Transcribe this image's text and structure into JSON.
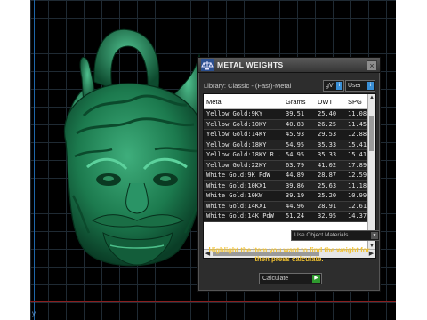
{
  "panel": {
    "title": "METAL WEIGHTS",
    "close": "×",
    "library_label": "Library: Classic - (Fast)-Metal",
    "button_gv": "gV",
    "button_user": "User",
    "indicator": "i"
  },
  "table": {
    "headers": [
      "Metal",
      "Grams",
      "DWT",
      "SPG"
    ],
    "rows": [
      [
        "Yellow Gold:9KY",
        "39.51",
        "25.40",
        "11.08"
      ],
      [
        "Yellow Gold:10KY",
        "40.83",
        "26.25",
        "11.45"
      ],
      [
        "Yellow Gold:14KY",
        "45.93",
        "29.53",
        "12.88"
      ],
      [
        "Yellow Gold:18KY",
        "54.95",
        "35.33",
        "15.41"
      ],
      [
        "Yellow Gold:18KY R...",
        "54.95",
        "35.33",
        "15.41"
      ],
      [
        "Yellow Gold:22KY",
        "63.79",
        "41.02",
        "17.89"
      ],
      [
        "White Gold:9K PdW",
        "44.89",
        "28.87",
        "12.59"
      ],
      [
        "White Gold:10KX1",
        "39.86",
        "25.63",
        "11.18"
      ],
      [
        "White Gold:10KW",
        "39.19",
        "25.20",
        "10.99"
      ],
      [
        "White Gold:14KX1",
        "44.96",
        "28.91",
        "12.61"
      ],
      [
        "White Gold:14K PdW",
        "51.24",
        "32.95",
        "14.37"
      ]
    ]
  },
  "use_object_materials": "Use Object Materials",
  "instruction": "Highlight the item you want to find the weight for then press calculate.",
  "calculate": "Calculate",
  "viewport": {
    "axis_label": "y"
  },
  "colors": {
    "accent_yellow": "#f1c232",
    "model_green": "#1e7a50",
    "viewport_bg": "#000000",
    "panel_bg": "#2d2d2d"
  }
}
